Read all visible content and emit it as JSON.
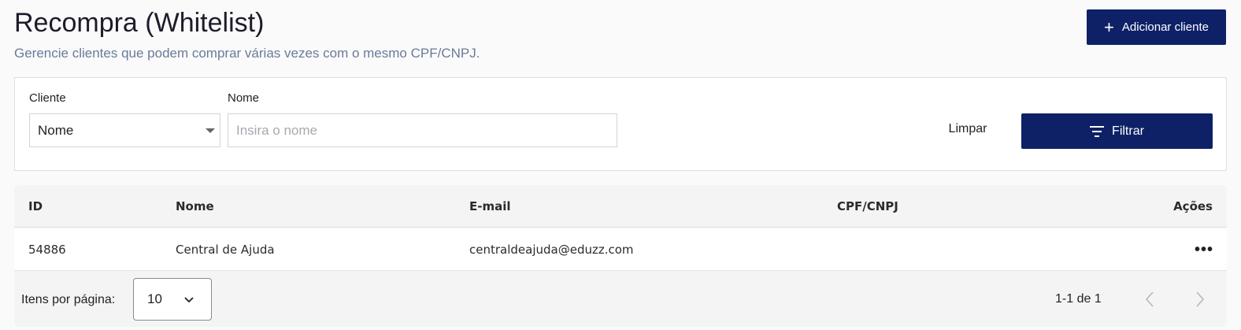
{
  "header": {
    "title": "Recompra (Whitelist)",
    "subtitle": "Gerencie clientes que podem comprar várias vezes com o mesmo CPF/CNPJ.",
    "add_button_label": "Adicionar cliente",
    "add_button_icon": "plus-icon"
  },
  "filters": {
    "client_label": "Cliente",
    "client_select_value": "Nome",
    "name_label": "Nome",
    "name_placeholder": "Insira o nome",
    "name_value": "",
    "clear_label": "Limpar",
    "filter_label": "Filtrar",
    "filter_icon": "filter-icon"
  },
  "table": {
    "columns": [
      "ID",
      "Nome",
      "E-mail",
      "CPF/CNPJ",
      "Ações"
    ],
    "rows": [
      {
        "id": "54886",
        "nome": "Central de Ajuda",
        "email": "centraldeajuda@eduzz.com",
        "cpf_cnpj": "",
        "actions_icon": "more-horizontal-icon"
      }
    ]
  },
  "pagination": {
    "per_page_label": "Itens por página:",
    "per_page_value": "10",
    "range_text": "1-1 de 1"
  },
  "colors": {
    "primary": "#0e2167",
    "subtitle": "#6b7a99",
    "background": "#fafafb"
  }
}
